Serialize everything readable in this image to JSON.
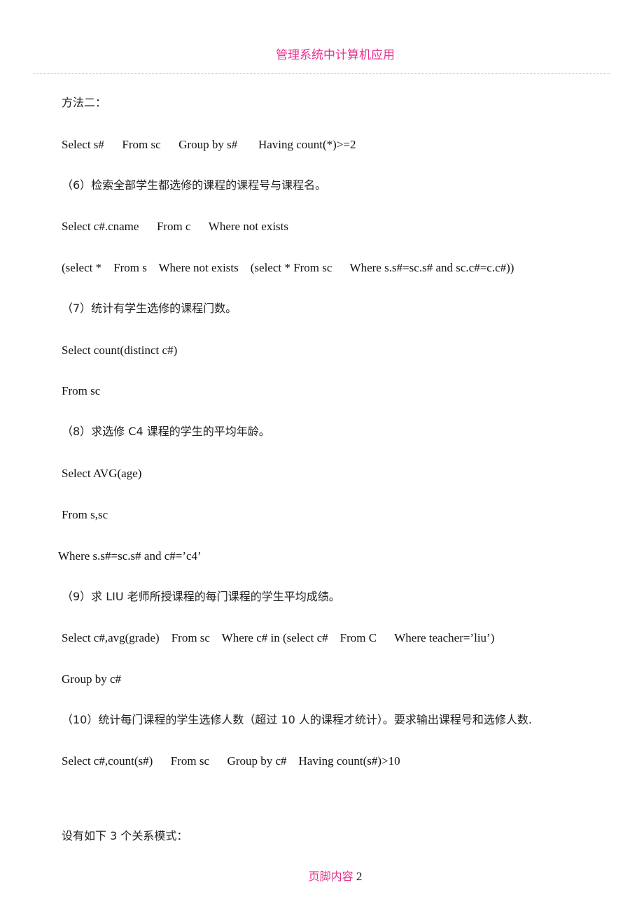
{
  "header": {
    "title": "管理系统中计算机应用"
  },
  "lines": [
    {
      "text": "方法二：",
      "kind": "cjk"
    },
    {
      "text": "Select s#      From sc      Group by s#       Having count(*)>=2",
      "kind": "code"
    },
    {
      "text": "（6）检索全部学生都选修的课程的课程号与课程名。",
      "kind": "cjk"
    },
    {
      "text": "Select c#.cname      From c      Where not exists",
      "kind": "code"
    },
    {
      "text": "(select *    From s    Where not exists    (select * From sc      Where s.s#=sc.s# and sc.c#=c.c#))",
      "kind": "code"
    },
    {
      "text": "（7）统计有学生选修的课程门数。",
      "kind": "cjk"
    },
    {
      "text": "Select count(distinct c#)",
      "kind": "code"
    },
    {
      "text": "From sc",
      "kind": "code"
    },
    {
      "text": "（8）求选修 C4 课程的学生的平均年龄。",
      "kind": "cjk"
    },
    {
      "text": "Select AVG(age)",
      "kind": "code"
    },
    {
      "text": "From s,sc",
      "kind": "code"
    },
    {
      "text": "Where s.s#=sc.s# and c#=’c4’",
      "kind": "code"
    },
    {
      "text": "（9）求 LIU 老师所授课程的每门课程的学生平均成绩。",
      "kind": "cjk"
    },
    {
      "text": "Select c#,avg(grade)    From sc    Where c# in (select c#    From C      Where teacher=’liu’)",
      "kind": "code"
    },
    {
      "text": "Group by c#",
      "kind": "code"
    },
    {
      "text": "（10）统计每门课程的学生选修人数（超过 10 人的课程才统计）。要求输出课程号和选修人数.",
      "kind": "cjk"
    },
    {
      "text": "Select c#,count(s#)      From sc      Group by c#    Having count(s#)>10",
      "kind": "code"
    },
    {
      "text": "设有如下 3 个关系模式：",
      "kind": "cjk"
    }
  ],
  "footer": {
    "label": "页脚内容",
    "page_number": "2"
  }
}
